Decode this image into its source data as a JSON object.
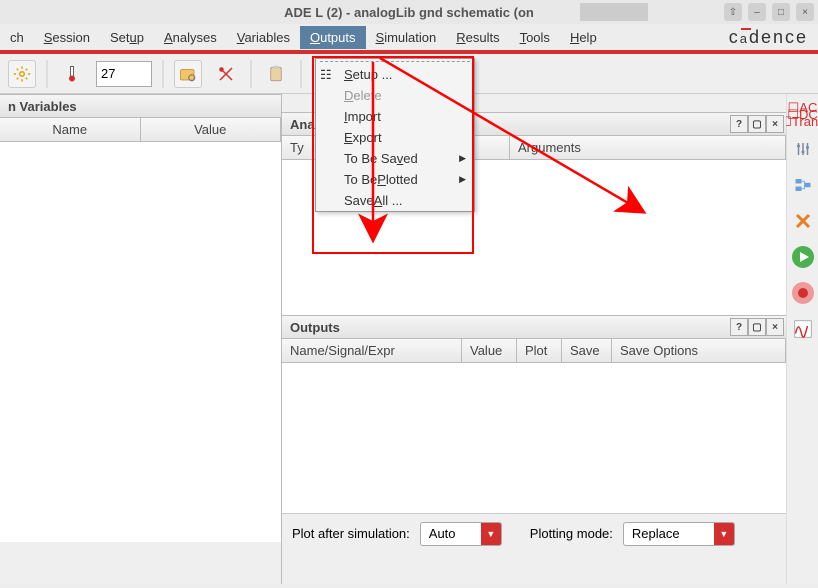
{
  "title": "ADE L (2) - analogLib gnd schematic (on",
  "menu": [
    "ch",
    "Session",
    "Setup",
    "Analyses",
    "Variables",
    "Outputs",
    "Simulation",
    "Results",
    "Tools",
    "Help"
  ],
  "menu_underline_idx": [
    -1,
    0,
    3,
    0,
    0,
    0,
    0,
    0,
    0,
    0
  ],
  "menu_active": 5,
  "brand": "cadence",
  "toolbar": {
    "temp_value": "27"
  },
  "left_panel": {
    "title": "n Variables",
    "cols": [
      "Name",
      "Value"
    ]
  },
  "analyses": {
    "title": "Ana",
    "cols": [
      "Ty",
      "",
      "Arguments"
    ]
  },
  "outputs": {
    "title": "Outputs",
    "cols": [
      "Name/Signal/Expr",
      "Value",
      "Plot",
      "Save",
      "Save Options"
    ]
  },
  "dropdown": [
    {
      "label": "Setup ...",
      "u": 0,
      "enabled": true,
      "hasIcon": true
    },
    {
      "label": "Delete",
      "u": 0,
      "enabled": false
    },
    {
      "label": "Import",
      "u": 0,
      "enabled": true
    },
    {
      "label": "Export",
      "u": 0,
      "enabled": true
    },
    {
      "label": "To Be Saved",
      "u": 8,
      "enabled": true,
      "sub": true
    },
    {
      "label": "To Be Plotted",
      "u": 6,
      "enabled": true,
      "sub": true
    },
    {
      "label": "Save All ...",
      "u": 5,
      "enabled": true
    }
  ],
  "bottom": {
    "plot_after_label": "Plot after simulation:",
    "plot_after_value": "Auto",
    "plotting_mode_label": "Plotting mode:",
    "plotting_mode_value": "Replace"
  },
  "side_labels": {
    "ac": "AC",
    "dc": "DC",
    "trans": "Trans"
  }
}
